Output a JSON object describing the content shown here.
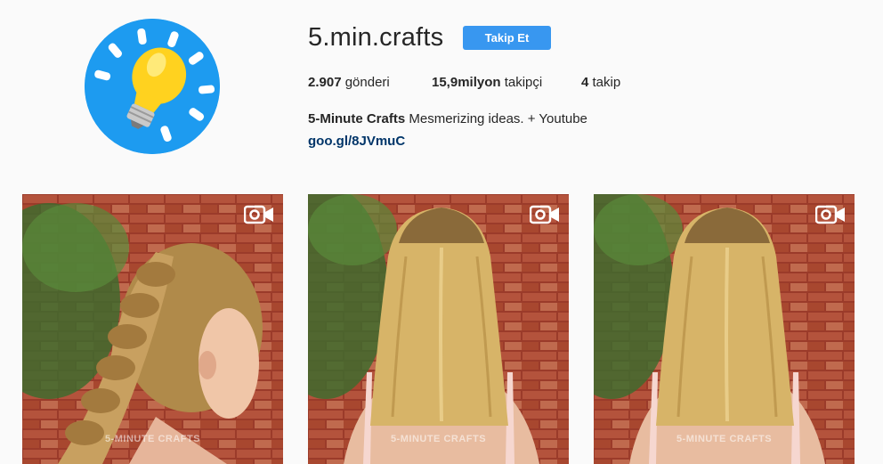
{
  "profile": {
    "username": "5.min.crafts",
    "follow_label": "Takip Et",
    "avatar_icon": "lightbulb-icon"
  },
  "stats": {
    "posts_count": "2.907",
    "posts_label": "gönderi",
    "followers_count": "15,9milyon",
    "followers_label": "takipçi",
    "following_count": "4",
    "following_label": "takip"
  },
  "bio": {
    "name": "5-Minute Crafts",
    "text": "Mesmerizing ideas. + Youtube",
    "link": "goo.gl/8JVmuC"
  },
  "posts": [
    {
      "type": "video",
      "icon": "video-camera-icon",
      "watermark": "5-MINUTE CRAFTS"
    },
    {
      "type": "video",
      "icon": "video-camera-icon",
      "watermark": "5-MINUTE CRAFTS"
    },
    {
      "type": "video",
      "icon": "video-camera-icon",
      "watermark": "5-MINUTE CRAFTS"
    }
  ],
  "colors": {
    "accent": "#3897f0",
    "avatar_bg": "#1d9bf0",
    "link": "#003569"
  }
}
